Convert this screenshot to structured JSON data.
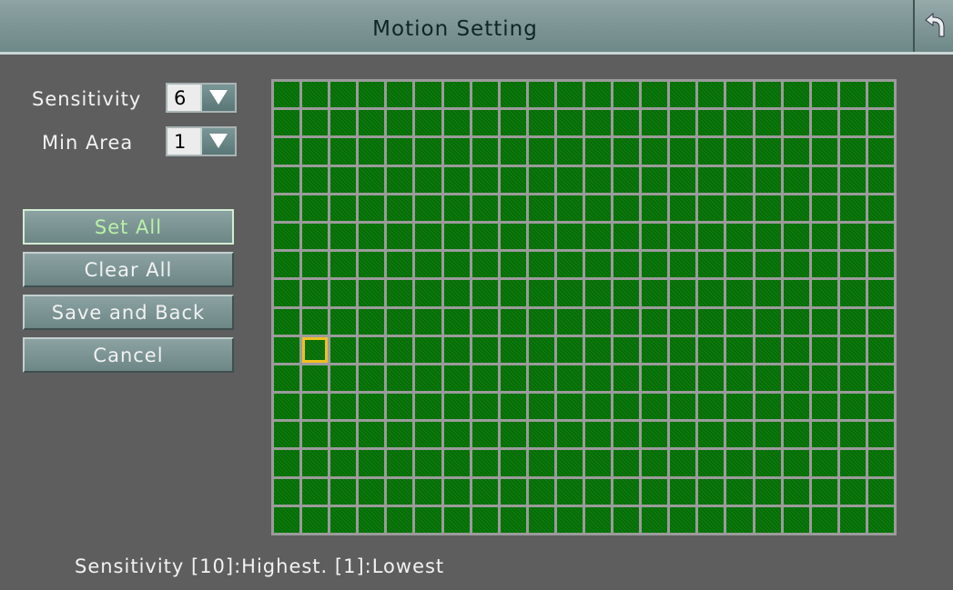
{
  "window": {
    "title": "Motion Setting"
  },
  "sensitivity": {
    "label": "Sensitivity",
    "value": "6"
  },
  "min_area": {
    "label": "Min Area",
    "value": "1"
  },
  "buttons": {
    "set_all": "Set All",
    "clear_all": "Clear All",
    "save_back": "Save and Back",
    "cancel": "Cancel"
  },
  "grid": {
    "columns": 22,
    "rows": 16,
    "cursor": {
      "row": 10,
      "col": 2
    }
  },
  "footer": {
    "hint": "Sensitivity  [10]:Highest.  [1]:Lowest"
  },
  "icons": {
    "back": "back-arrow-icon",
    "dropdown": "triangle-down-icon"
  },
  "colors": {
    "cell": "#0a7a0a",
    "cursor": "#f0c020"
  }
}
